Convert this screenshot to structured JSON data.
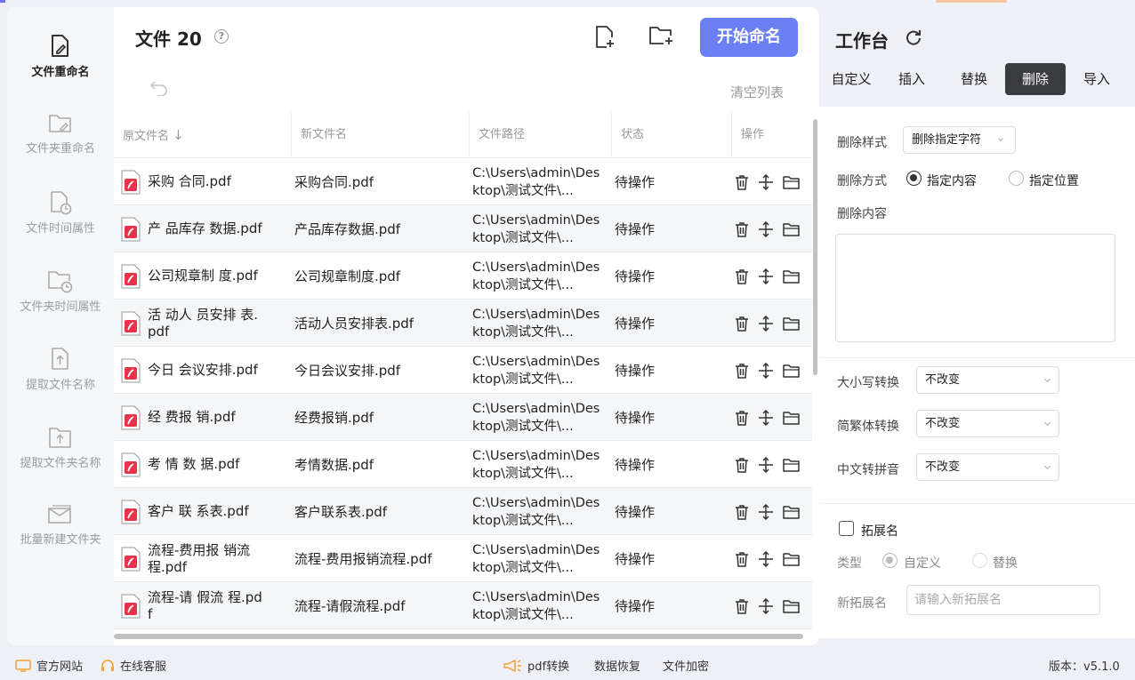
{
  "sidebar": {
    "items": [
      {
        "label": "文件重命名",
        "icon": "file-edit-icon",
        "active": true
      },
      {
        "label": "文件夹重命名",
        "icon": "folder-edit-icon"
      },
      {
        "label": "文件时间属性",
        "icon": "file-clock-icon"
      },
      {
        "label": "文件夹时间属性",
        "icon": "folder-clock-icon"
      },
      {
        "label": "提取文件名称",
        "icon": "file-extract-icon"
      },
      {
        "label": "提取文件夹名称",
        "icon": "folder-extract-icon"
      },
      {
        "label": "批量新建文件夹",
        "icon": "folder-batch-icon"
      }
    ]
  },
  "main": {
    "title": "文件 20",
    "help": "?",
    "start_button": "开始命名",
    "clear_label": "清空列表",
    "columns": [
      "原文件名",
      "新文件名",
      "文件路径",
      "状态",
      "操作"
    ],
    "rows": [
      {
        "orig": "采购  合同.pdf",
        "new": "采购合同.pdf",
        "path": "C:\\Users\\admin\\Desktop\\测试文件\\...",
        "status": "待操作"
      },
      {
        "orig": "产  品库存 数据.pdf",
        "new": "产品库存数据.pdf",
        "path": "C:\\Users\\admin\\Desktop\\测试文件\\...",
        "status": "待操作"
      },
      {
        "orig": "公司规章制  度.pdf",
        "new": "公司规章制度.pdf",
        "path": "C:\\Users\\admin\\Desktop\\测试文件\\...",
        "status": "待操作"
      },
      {
        "orig": "活  动人 员安排  表.pdf",
        "new": "活动人员安排表.pdf",
        "path": "C:\\Users\\admin\\Desktop\\测试文件\\...",
        "status": "待操作"
      },
      {
        "orig": "今日    会议安排.pdf",
        "new": "今日会议安排.pdf",
        "path": "C:\\Users\\admin\\Desktop\\测试文件\\...",
        "status": "待操作"
      },
      {
        "orig": "经 费报 销.pdf",
        "new": "经费报销.pdf",
        "path": "C:\\Users\\admin\\Desktop\\测试文件\\...",
        "status": "待操作"
      },
      {
        "orig": "考  情 数 据.pdf",
        "new": "考情数据.pdf",
        "path": "C:\\Users\\admin\\Desktop\\测试文件\\...",
        "status": "待操作"
      },
      {
        "orig": "客户 联 系表.pdf",
        "new": "客户联系表.pdf",
        "path": "C:\\Users\\admin\\Desktop\\测试文件\\...",
        "status": "待操作"
      },
      {
        "orig": "流程-费用报   销流程.pdf",
        "new": "流程-费用报销流程.pdf",
        "path": "C:\\Users\\admin\\Desktop\\测试文件\\...",
        "status": "待操作"
      },
      {
        "orig": "流程-请    假流    程.pdf",
        "new": "流程-请假流程.pdf",
        "path": "C:\\Users\\admin\\Desktop\\测试文件\\...",
        "status": "待操作"
      }
    ]
  },
  "right_panel": {
    "title": "工作台",
    "tabs": [
      "自定义",
      "插入",
      "替换",
      "删除",
      "导入"
    ],
    "active_tab": "删除",
    "delete_style_label": "删除样式",
    "delete_style_value": "删除指定字符",
    "delete_mode_label": "删除方式",
    "delete_mode_options": [
      "指定内容",
      "指定位置"
    ],
    "delete_content_label": "删除内容",
    "case_label": "大小写转换",
    "case_value": "不改变",
    "trad_label": "简繁体转换",
    "trad_value": "不改变",
    "pinyin_label": "中文转拼音",
    "pinyin_value": "不改变",
    "ext_label": "拓展名",
    "type_label": "类型",
    "type_options": [
      "自定义",
      "替换"
    ],
    "new_ext_label": "新拓展名",
    "new_ext_placeholder": "请输入新拓展名"
  },
  "footer": {
    "website": "官方网站",
    "service": "在线客服",
    "pdf": "pdf转换",
    "recovery": "数据恢复",
    "encrypt": "文件加密",
    "version": "版本：v5.1.0"
  },
  "colors": {
    "accent": "#6b7ff5",
    "active_tab": "#3a3b3f",
    "pdf_red": "#e8334a"
  }
}
